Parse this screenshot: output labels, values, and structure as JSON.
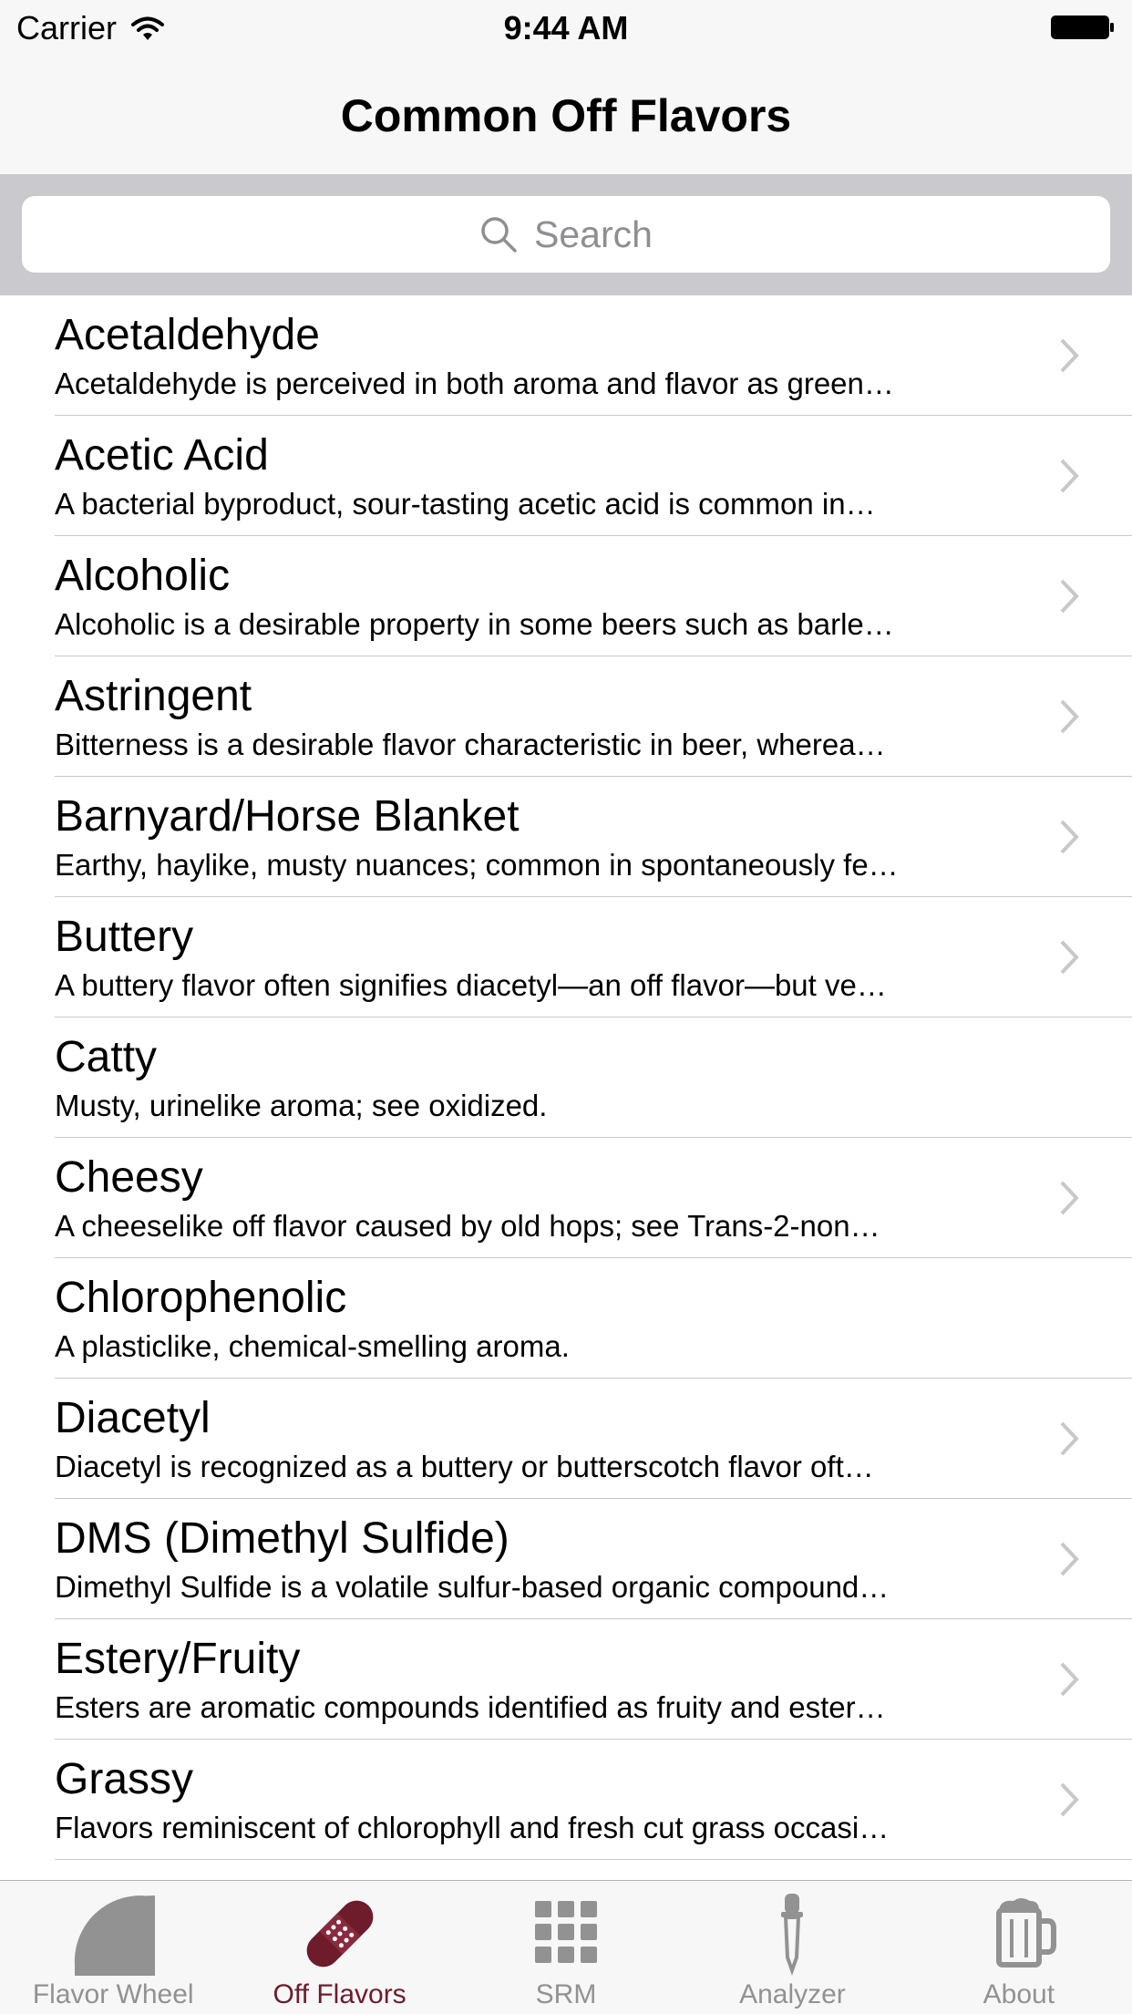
{
  "status_bar": {
    "carrier": "Carrier",
    "time": "9:44 AM"
  },
  "nav": {
    "title": "Common Off Flavors"
  },
  "search": {
    "placeholder": "Search"
  },
  "colors": {
    "accent": "#6e1b2c",
    "inactive": "#929292",
    "separator": "#c8c7cc"
  },
  "flavors": [
    {
      "title": "Acetaldehyde",
      "subtitle": "Acetaldehyde is perceived in both aroma and flavor as green…",
      "has_chevron": true
    },
    {
      "title": "Acetic Acid",
      "subtitle": "A bacterial byproduct, sour-tasting acetic acid is common in…",
      "has_chevron": true
    },
    {
      "title": "Alcoholic",
      "subtitle": "Alcoholic is a desirable property in some beers such as barle…",
      "has_chevron": true
    },
    {
      "title": "Astringent",
      "subtitle": "Bitterness is a desirable flavor characteristic in beer, wherea…",
      "has_chevron": true
    },
    {
      "title": "Barnyard/Horse Blanket",
      "subtitle": "Earthy, haylike, musty nuances; common in spontaneously fe…",
      "has_chevron": true
    },
    {
      "title": "Buttery",
      "subtitle": "A buttery flavor often signifies diacetyl—an off flavor—but ve…",
      "has_chevron": true
    },
    {
      "title": "Catty",
      "subtitle": "Musty, urinelike aroma; see oxidized.",
      "has_chevron": false
    },
    {
      "title": "Cheesy",
      "subtitle": "A cheeselike off flavor caused by old hops; see Trans-2-non…",
      "has_chevron": true
    },
    {
      "title": "Chlorophenolic",
      "subtitle": "A plasticlike, chemical-smelling aroma.",
      "has_chevron": false
    },
    {
      "title": "Diacetyl",
      "subtitle": "Diacetyl is recognized as a buttery or butterscotch flavor oft…",
      "has_chevron": true
    },
    {
      "title": "DMS (Dimethyl Sulfide)",
      "subtitle": "Dimethyl Sulfide is a volatile sulfur-based organic compound…",
      "has_chevron": true
    },
    {
      "title": "Estery/Fruity",
      "subtitle": "Esters are aromatic compounds identified as fruity and ester…",
      "has_chevron": true
    },
    {
      "title": "Grassy",
      "subtitle": "Flavors reminiscent of chlorophyll and fresh cut grass occasi…",
      "has_chevron": true
    }
  ],
  "tabs": [
    {
      "label": "Flavor Wheel",
      "icon": "flavor-wheel-icon",
      "active": false
    },
    {
      "label": "Off Flavors",
      "icon": "bandage-icon",
      "active": true
    },
    {
      "label": "SRM",
      "icon": "grid-icon",
      "active": false
    },
    {
      "label": "Analyzer",
      "icon": "dropper-icon",
      "active": false
    },
    {
      "label": "About",
      "icon": "beer-mug-icon",
      "active": false
    }
  ]
}
